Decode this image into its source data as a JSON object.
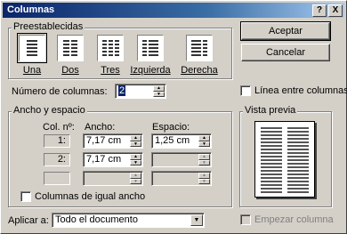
{
  "window": {
    "title": "Columnas"
  },
  "title_buttons": {
    "help": "?",
    "close": "X"
  },
  "presets": {
    "group_label": "Preestablecidas",
    "items": [
      {
        "label": "Una",
        "icon": "one-column-icon",
        "selected": true
      },
      {
        "label": "Dos",
        "icon": "two-columns-icon",
        "selected": false
      },
      {
        "label": "Tres",
        "icon": "three-columns-icon",
        "selected": false
      },
      {
        "label": "Izquierda",
        "icon": "left-column-icon",
        "selected": false
      },
      {
        "label": "Derecha",
        "icon": "right-column-icon",
        "selected": false
      }
    ]
  },
  "buttons": {
    "ok": "Aceptar",
    "cancel": "Cancelar"
  },
  "num_columns": {
    "label": "Número de columnas:",
    "value": "2"
  },
  "line_between": {
    "label": "Línea entre columnas",
    "checked": false
  },
  "width_spacing": {
    "group_label": "Ancho y espacio",
    "col_header": "Col. nº:",
    "width_header": "Ancho:",
    "spacing_header": "Espacio:",
    "rows": [
      {
        "col": "1:",
        "width": "7,17 cm",
        "spacing": "1,25 cm"
      },
      {
        "col": "2:",
        "width": "7,17 cm",
        "spacing": ""
      },
      {
        "col": "",
        "width": "",
        "spacing": ""
      }
    ]
  },
  "equal_width": {
    "label": "Columnas de igual ancho",
    "checked": false
  },
  "preview": {
    "label": "Vista previa"
  },
  "apply_to": {
    "label": "Aplicar a:",
    "value": "Todo el documento"
  },
  "start_new_column": {
    "label": "Empezar columna",
    "checked": false,
    "disabled": true
  }
}
